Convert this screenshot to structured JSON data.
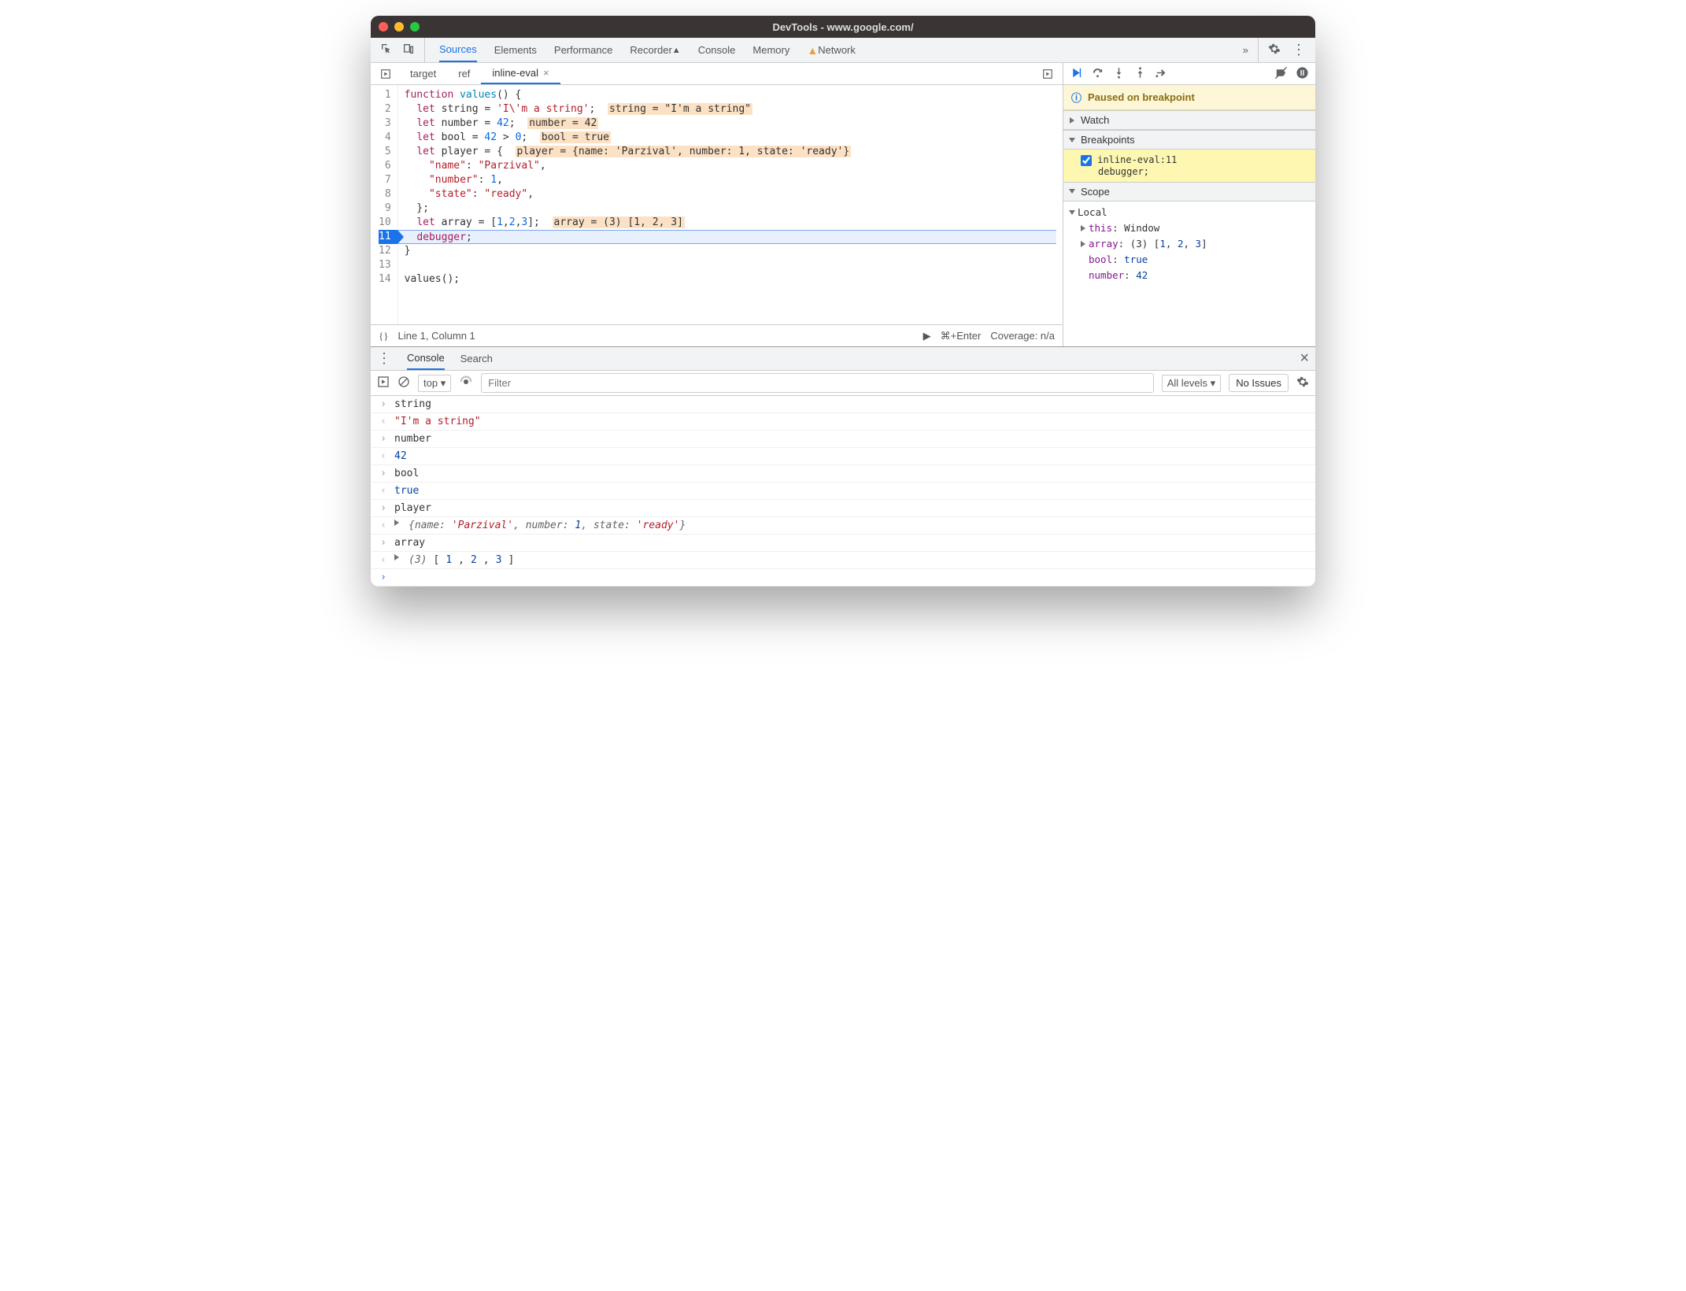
{
  "window": {
    "title": "DevTools - www.google.com/"
  },
  "toolbar": {
    "tabs": [
      "Sources",
      "Elements",
      "Performance",
      "Recorder",
      "Console",
      "Memory",
      "Network"
    ],
    "active": "Sources",
    "network_warning": true
  },
  "file_tabs": {
    "items": [
      {
        "label": "target",
        "active": false,
        "closeable": false
      },
      {
        "label": "ref",
        "active": false,
        "closeable": false
      },
      {
        "label": "inline-eval",
        "active": true,
        "closeable": true
      }
    ]
  },
  "code": {
    "lines": [
      {
        "n": 1,
        "html": "<span class='kw'>function</span> <span class='def'>values</span>() {"
      },
      {
        "n": 2,
        "html": "  <span class='kw'>let</span> string = <span class='str'>'I\\'m a string'</span>;  <span class='hint'>string = \"I'm a string\"</span>"
      },
      {
        "n": 3,
        "html": "  <span class='kw'>let</span> number = <span class='num'>42</span>;  <span class='hint'>number = 42</span>"
      },
      {
        "n": 4,
        "html": "  <span class='kw'>let</span> bool = <span class='num'>42</span> > <span class='num'>0</span>;  <span class='hint'>bool = true</span>"
      },
      {
        "n": 5,
        "html": "  <span class='kw'>let</span> player = {  <span class='hint'>player = {name: 'Parzival', number: 1, state: 'ready'}</span>"
      },
      {
        "n": 6,
        "html": "    <span class='prop'>\"name\"</span>: <span class='str'>\"Parzival\"</span>,"
      },
      {
        "n": 7,
        "html": "    <span class='prop'>\"number\"</span>: <span class='num'>1</span>,"
      },
      {
        "n": 8,
        "html": "    <span class='prop'>\"state\"</span>: <span class='str'>\"ready\"</span>,"
      },
      {
        "n": 9,
        "html": "  };"
      },
      {
        "n": 10,
        "html": "  <span class='kw'>let</span> array = [<span class='num'>1</span>,<span class='num'>2</span>,<span class='num'>3</span>];  <span class='hint'>array = (3) [1, 2, 3]</span>"
      },
      {
        "n": 11,
        "html": "  <span class='dbg'>debugger</span>;",
        "breakpoint": true,
        "current": true
      },
      {
        "n": 12,
        "html": "}"
      },
      {
        "n": 13,
        "html": ""
      },
      {
        "n": 14,
        "html": "values();"
      }
    ]
  },
  "status": {
    "pretty_print": "{}",
    "position": "Line 1, Column 1",
    "run_hint": "⌘+Enter",
    "coverage": "Coverage: n/a"
  },
  "debugger": {
    "paused_label": "Paused on breakpoint",
    "sections": {
      "watch": "Watch",
      "breakpoints": "Breakpoints",
      "scope": "Scope"
    },
    "breakpoints": [
      {
        "checked": true,
        "location": "inline-eval:11",
        "code": "debugger;"
      }
    ],
    "scope": {
      "title": "Local",
      "entries": [
        {
          "expandable": true,
          "name": "this",
          "value": "Window",
          "type": "obj"
        },
        {
          "expandable": true,
          "name": "array",
          "value": "(3) [1, 2, 3]",
          "type": "arr"
        },
        {
          "expandable": false,
          "name": "bool",
          "value": "true",
          "type": "bool"
        },
        {
          "expandable": false,
          "name": "number",
          "value": "42",
          "type": "num"
        }
      ]
    }
  },
  "drawer": {
    "tabs": [
      "Console",
      "Search"
    ],
    "active": "Console",
    "context": "top",
    "filter_placeholder": "Filter",
    "levels": "All levels",
    "issues": "No Issues"
  },
  "console": [
    {
      "dir": "in",
      "text": "string"
    },
    {
      "dir": "out",
      "type": "str",
      "text": "\"I'm a string\""
    },
    {
      "dir": "in",
      "text": "number"
    },
    {
      "dir": "out",
      "type": "num",
      "text": "42"
    },
    {
      "dir": "in",
      "text": "bool"
    },
    {
      "dir": "out",
      "type": "bool",
      "text": "true"
    },
    {
      "dir": "in",
      "text": "player"
    },
    {
      "dir": "out",
      "type": "obj",
      "text": "{name: 'Parzival', number: 1, state: 'ready'}"
    },
    {
      "dir": "in",
      "text": "array"
    },
    {
      "dir": "out",
      "type": "arr",
      "text": "(3) [1, 2, 3]"
    }
  ]
}
